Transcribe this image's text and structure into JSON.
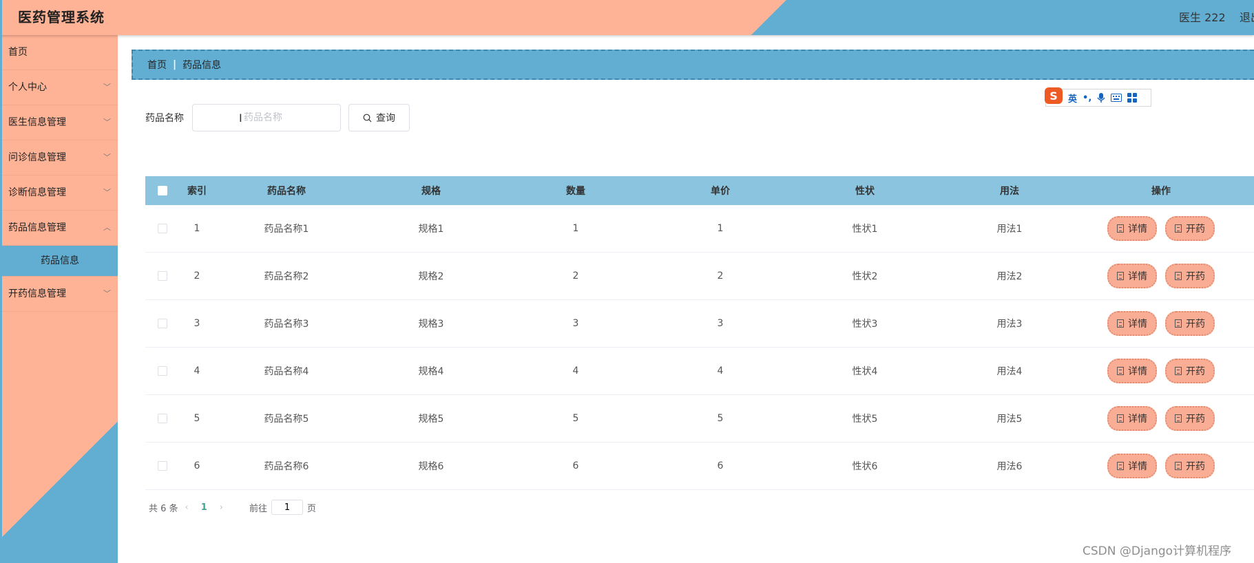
{
  "app": {
    "title": "医药管理系统",
    "user": "医生 222",
    "logout": "退出"
  },
  "sidebar": {
    "items": [
      {
        "label": "首页",
        "has_arrow": false
      },
      {
        "label": "个人中心",
        "has_arrow": true
      },
      {
        "label": "医生信息管理",
        "has_arrow": true
      },
      {
        "label": "问诊信息管理",
        "has_arrow": true
      },
      {
        "label": "诊断信息管理",
        "has_arrow": true
      },
      {
        "label": "药品信息管理",
        "has_arrow": true,
        "expanded": true
      },
      {
        "label": "开药信息管理",
        "has_arrow": true
      }
    ],
    "sub_item_active": "药品信息",
    "arrow_icon": "chevron-down-icon"
  },
  "breadcrumb": {
    "home": "首页",
    "current": "药品信息"
  },
  "ime_toolbar": {
    "logo": "S",
    "mode": "英",
    "punct": "•,",
    "icons": [
      "microphone-icon",
      "keyboard-icon",
      "grid-icon"
    ]
  },
  "search": {
    "label": "药品名称",
    "placeholder": "药品名称",
    "value": "",
    "button_label": "查询",
    "button_icon": "search-icon"
  },
  "table": {
    "headers": [
      "索引",
      "药品名称",
      "规格",
      "数量",
      "单价",
      "性状",
      "用法",
      "操作"
    ],
    "rows": [
      [
        "1",
        "药品名称1",
        "规格1",
        "1",
        "1",
        "性状1",
        "用法1"
      ],
      [
        "2",
        "药品名称2",
        "规格2",
        "2",
        "2",
        "性状2",
        "用法2"
      ],
      [
        "3",
        "药品名称3",
        "规格3",
        "3",
        "3",
        "性状3",
        "用法3"
      ],
      [
        "4",
        "药品名称4",
        "规格4",
        "4",
        "4",
        "性状4",
        "用法4"
      ],
      [
        "5",
        "药品名称5",
        "规格5",
        "5",
        "5",
        "性状5",
        "用法5"
      ],
      [
        "6",
        "药品名称6",
        "规格6",
        "6",
        "6",
        "性状6",
        "用法6"
      ]
    ],
    "actions": [
      "详情",
      "开药"
    ],
    "action_icon": "document-icon"
  },
  "pagination": {
    "total": "共 6 条",
    "current": "1",
    "goto_prefix": "前往",
    "goto_value": "1",
    "goto_suffix": "页"
  },
  "watermark": "CSDN @Django计算机程序",
  "colors": {
    "accent_salmon": "#ffb396",
    "accent_blue": "#62aed2",
    "table_header": "#8bc4df",
    "page_active": "#42a58f"
  }
}
